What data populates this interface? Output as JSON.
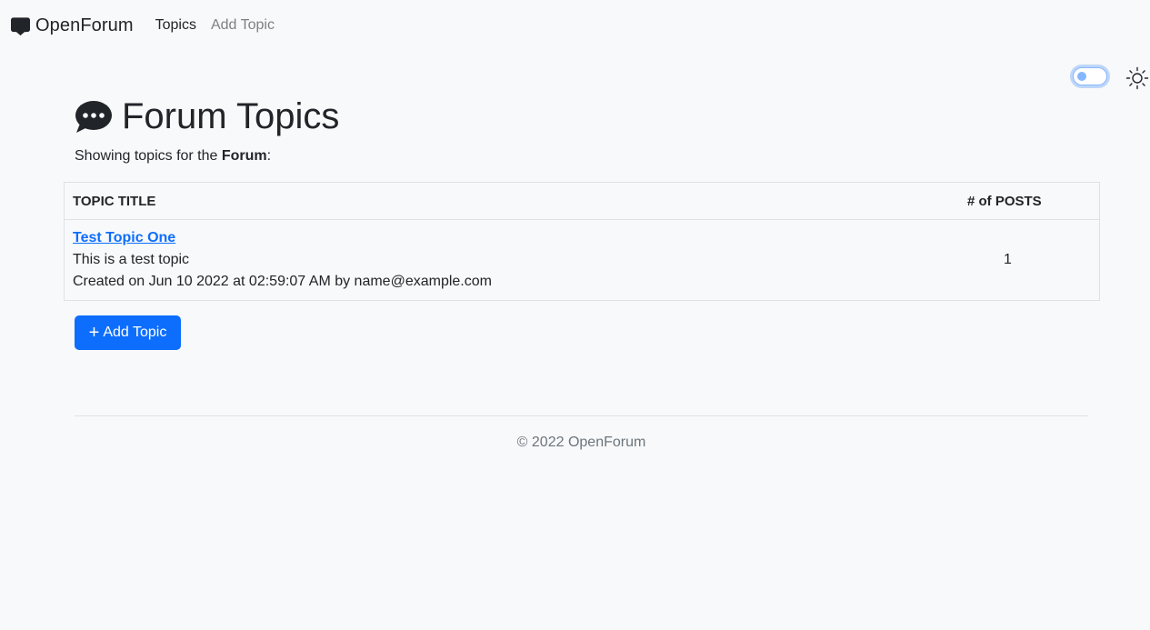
{
  "navbar": {
    "brand_icon": "chat-square-fill-icon",
    "brand": "OpenForum",
    "links": [
      {
        "label": "Topics",
        "active": true
      },
      {
        "label": "Add Topic",
        "active": false
      }
    ]
  },
  "theme": {
    "toggle_state": "off",
    "icon": "sun-icon"
  },
  "page": {
    "title_icon": "chat-dots-fill-icon",
    "title": "Forum Topics",
    "subtitle_prefix": "Showing topics for the ",
    "forum_name": "Forum",
    "subtitle_suffix": ":"
  },
  "table": {
    "headers": [
      "TOPIC TITLE",
      "# of POSTS"
    ],
    "rows": [
      {
        "title": "Test Topic One",
        "description": "This is a test topic",
        "meta": "Created on Jun 10 2022 at 02:59:07 AM by name@example.com",
        "posts": "1"
      }
    ]
  },
  "actions": {
    "add_topic_icon": "plus-icon",
    "add_topic": "Add Topic"
  },
  "footer": {
    "text": "© 2022 OpenForum"
  },
  "colors": {
    "accent": "#0d6efd",
    "background": "#f8f9fa",
    "muted_text": "#6c757d"
  }
}
